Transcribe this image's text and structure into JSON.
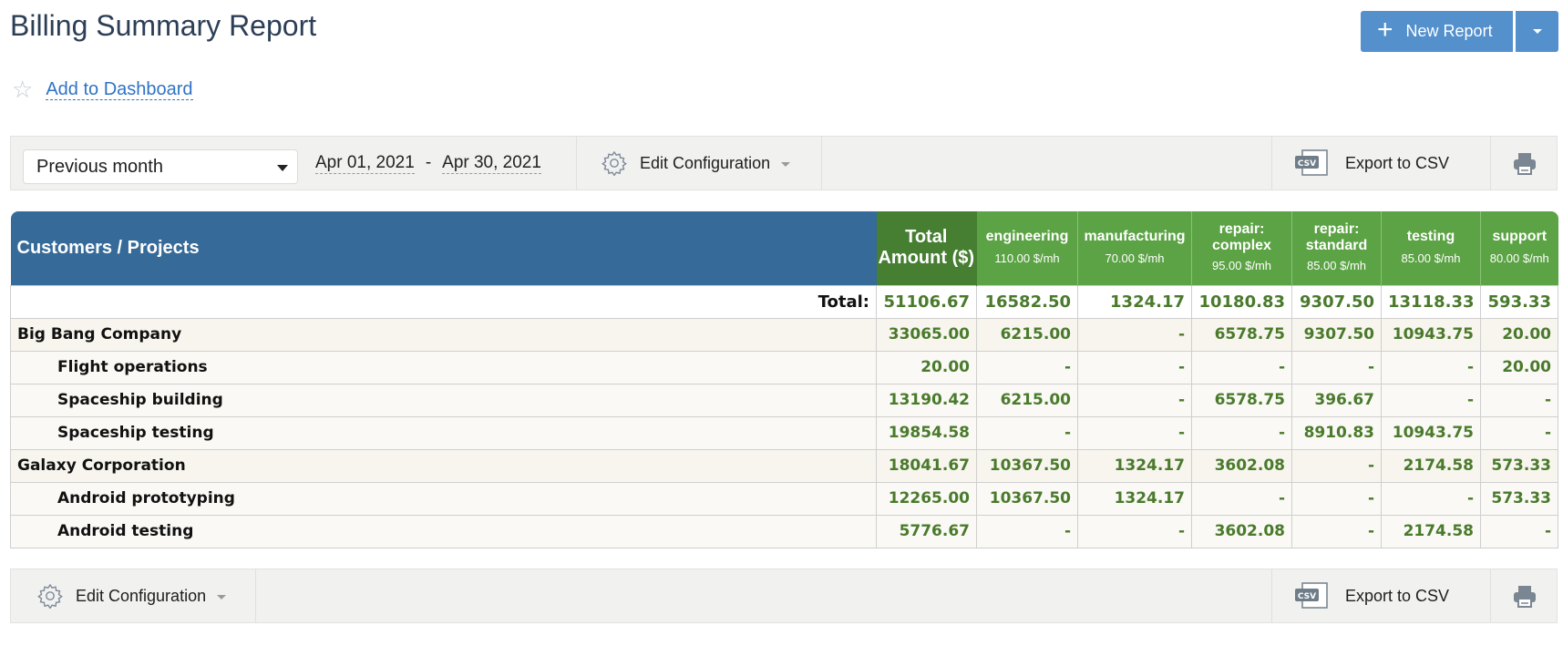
{
  "header": {
    "title": "Billing Summary Report",
    "new_report_label": "New Report",
    "add_dashboard_label": "Add to Dashboard"
  },
  "toolbar": {
    "period_selected": "Previous month",
    "date_from": "Apr 01, 2021",
    "date_separator": "-",
    "date_to": "Apr 30, 2021",
    "edit_config_label": "Edit Configuration",
    "export_label": "Export to CSV",
    "csv_icon_text": "CSV"
  },
  "table": {
    "first_column_header": "Customers / Projects",
    "total_header": "Total Amount ($)",
    "activities": [
      {
        "name": "engineering",
        "rate": "110.00 $/mh"
      },
      {
        "name": "manufacturing",
        "rate": "70.00 $/mh"
      },
      {
        "name": "repair: complex",
        "rate": "95.00 $/mh"
      },
      {
        "name": "repair: standard",
        "rate": "85.00 $/mh"
      },
      {
        "name": "testing",
        "rate": "85.00 $/mh"
      },
      {
        "name": "support",
        "rate": "80.00 $/mh"
      }
    ],
    "total_row": {
      "label": "Total:",
      "values": [
        "51106.67",
        "16582.50",
        "1324.17",
        "10180.83",
        "9307.50",
        "13118.33",
        "593.33"
      ]
    },
    "rows": [
      {
        "type": "customer",
        "name": "Big Bang Company",
        "values": [
          "33065.00",
          "6215.00",
          "-",
          "6578.75",
          "9307.50",
          "10943.75",
          "20.00"
        ]
      },
      {
        "type": "project",
        "name": "Flight operations",
        "values": [
          "20.00",
          "-",
          "-",
          "-",
          "-",
          "-",
          "20.00"
        ]
      },
      {
        "type": "project",
        "name": "Spaceship building",
        "values": [
          "13190.42",
          "6215.00",
          "-",
          "6578.75",
          "396.67",
          "-",
          "-"
        ]
      },
      {
        "type": "project",
        "name": "Spaceship testing",
        "values": [
          "19854.58",
          "-",
          "-",
          "-",
          "8910.83",
          "10943.75",
          "-"
        ]
      },
      {
        "type": "customer",
        "name": "Galaxy Corporation",
        "values": [
          "18041.67",
          "10367.50",
          "1324.17",
          "3602.08",
          "-",
          "2174.58",
          "573.33"
        ]
      },
      {
        "type": "project",
        "name": "Android prototyping",
        "values": [
          "12265.00",
          "10367.50",
          "1324.17",
          "-",
          "-",
          "-",
          "573.33"
        ]
      },
      {
        "type": "project",
        "name": "Android testing",
        "values": [
          "5776.67",
          "-",
          "-",
          "3602.08",
          "-",
          "2174.58",
          "-"
        ]
      }
    ]
  },
  "colors": {
    "primary_button": "#5390cc",
    "customers_header": "#366a99",
    "total_header": "#467e32",
    "activity_header": "#5ca345",
    "amount_text": "#4a7a2c"
  }
}
